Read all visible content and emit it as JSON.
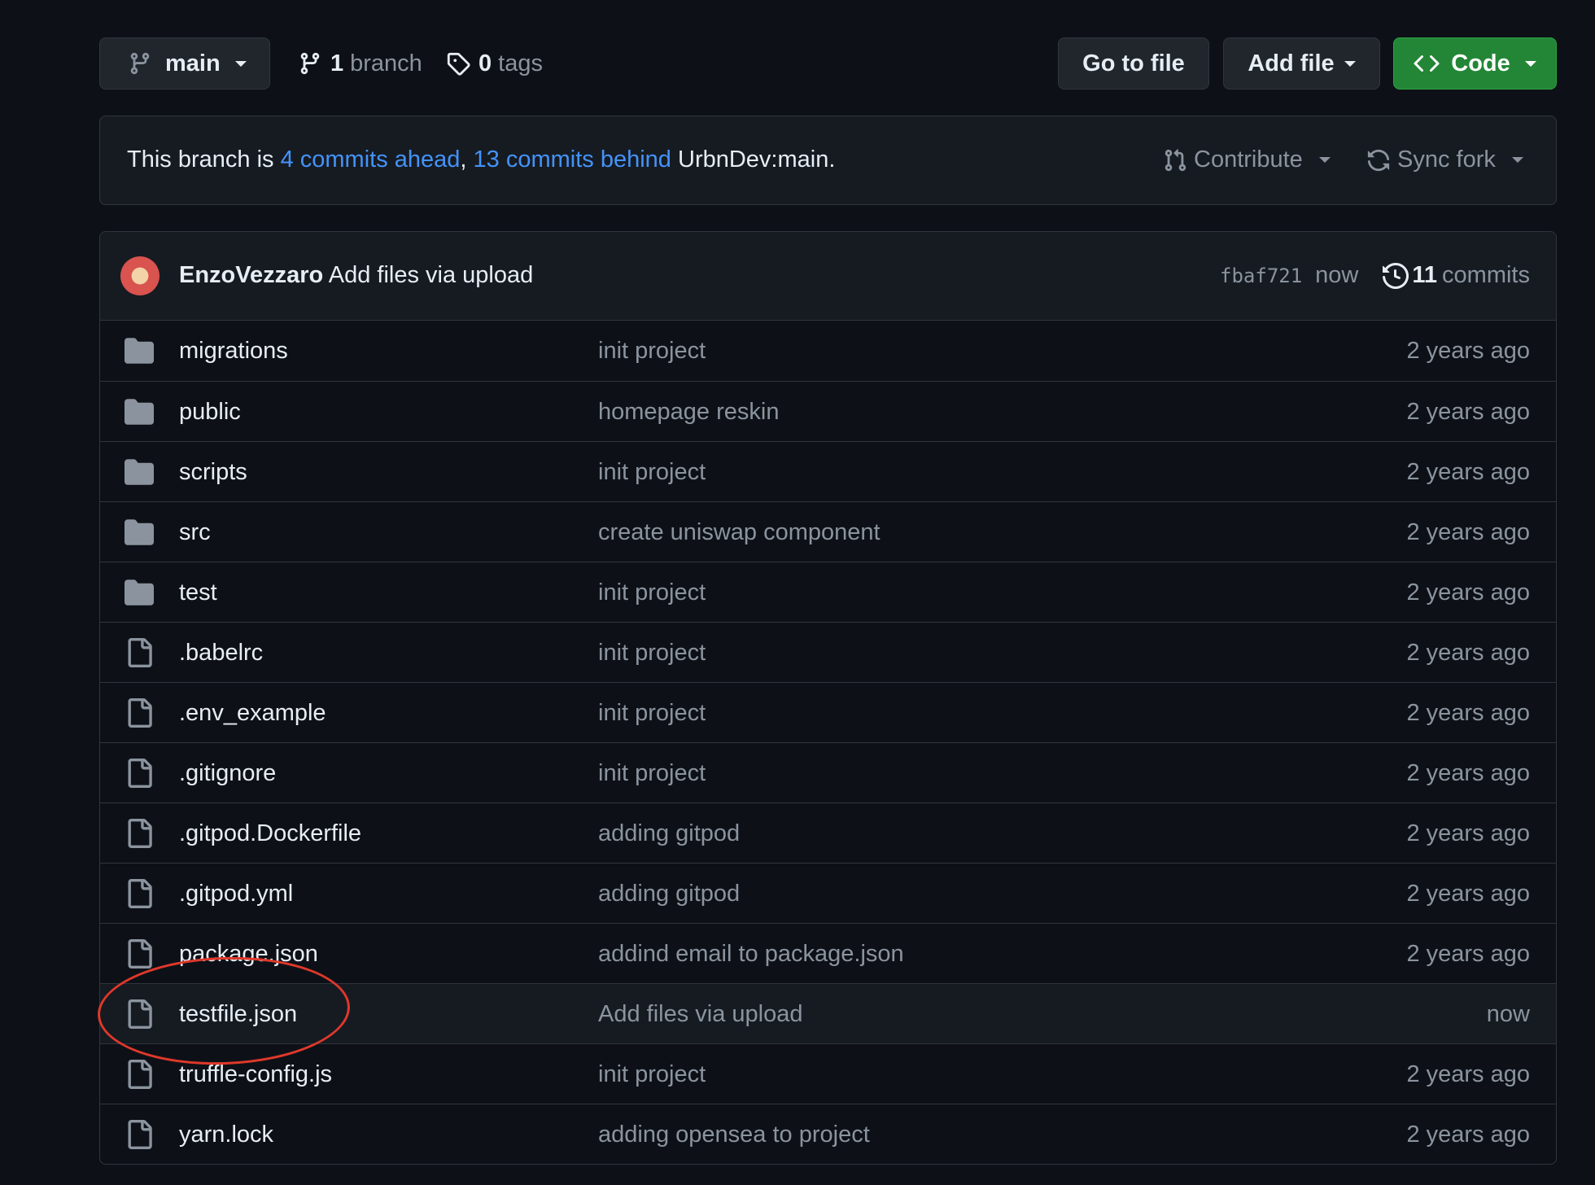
{
  "toolbar": {
    "branch_label": "main",
    "branch_count": "1",
    "branch_word": "branch",
    "tag_count": "0",
    "tag_word": "tags",
    "go_to_file": "Go to file",
    "add_file": "Add file",
    "code": "Code"
  },
  "branch_info": {
    "prefix": "This branch is ",
    "ahead": "4 commits ahead",
    "sep": ", ",
    "behind": "13 commits behind",
    "suffix": " UrbnDev:main.",
    "contribute": "Contribute",
    "sync_fork": "Sync fork"
  },
  "latest_commit": {
    "author": "EnzoVezzaro",
    "message": " Add files via upload",
    "sha": "fbaf721",
    "time": "now",
    "commit_count": "11",
    "commit_word": "commits"
  },
  "files": [
    {
      "type": "dir",
      "name": "migrations",
      "message": "init project",
      "age": "2 years ago"
    },
    {
      "type": "dir",
      "name": "public",
      "message": "homepage reskin",
      "age": "2 years ago"
    },
    {
      "type": "dir",
      "name": "scripts",
      "message": "init project",
      "age": "2 years ago"
    },
    {
      "type": "dir",
      "name": "src",
      "message": "create uniswap component",
      "age": "2 years ago"
    },
    {
      "type": "dir",
      "name": "test",
      "message": "init project",
      "age": "2 years ago"
    },
    {
      "type": "file",
      "name": ".babelrc",
      "message": "init project",
      "age": "2 years ago"
    },
    {
      "type": "file",
      "name": ".env_example",
      "message": "init project",
      "age": "2 years ago"
    },
    {
      "type": "file",
      "name": ".gitignore",
      "message": "init project",
      "age": "2 years ago"
    },
    {
      "type": "file",
      "name": ".gitpod.Dockerfile",
      "message": "adding gitpod",
      "age": "2 years ago"
    },
    {
      "type": "file",
      "name": ".gitpod.yml",
      "message": "adding gitpod",
      "age": "2 years ago"
    },
    {
      "type": "file",
      "name": "package.json",
      "message": "addind email to package.json",
      "age": "2 years ago"
    },
    {
      "type": "file",
      "name": "testfile.json",
      "message": "Add files via upload",
      "age": "now",
      "highlighted": true
    },
    {
      "type": "file",
      "name": "truffle-config.js",
      "message": "init project",
      "age": "2 years ago"
    },
    {
      "type": "file",
      "name": "yarn.lock",
      "message": "adding opensea to project",
      "age": "2 years ago"
    }
  ],
  "colors": {
    "background": "#0d1117",
    "accent_link": "#4493f8",
    "code_button": "#238636",
    "annotation": "#e0382b"
  }
}
